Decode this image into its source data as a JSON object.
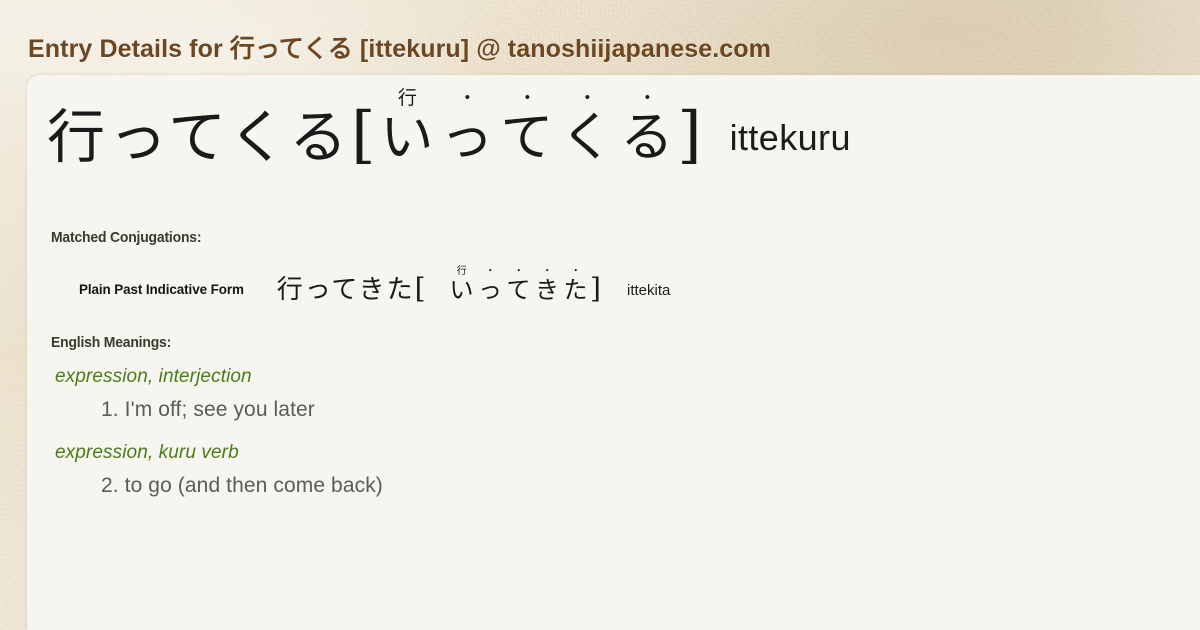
{
  "header": {
    "title": "Entry Details for 行ってくる [ittekuru] @ tanoshiijapanese.com",
    "title_color": "#6d4722"
  },
  "entry": {
    "headword": "行ってくる",
    "bracket_open": "[",
    "bracket_close": "]",
    "romaji": "ittekuru",
    "reading_units": [
      {
        "ruby": "行",
        "base": "い"
      },
      {
        "ruby": "・",
        "base": "っ"
      },
      {
        "ruby": "・",
        "base": "て"
      },
      {
        "ruby": "・",
        "base": "く"
      },
      {
        "ruby": "・",
        "base": "る"
      }
    ]
  },
  "conjugations": {
    "label": "Matched Conjugations:",
    "items": [
      {
        "name": "Plain Past Indicative Form",
        "kanji": "行ってきた",
        "bracket_open": "[",
        "bracket_close": "]",
        "romaji": "ittekita",
        "reading_units": [
          {
            "ruby": "行",
            "base": "い"
          },
          {
            "ruby": "・",
            "base": "っ"
          },
          {
            "ruby": "・",
            "base": "て"
          },
          {
            "ruby": "・",
            "base": "き"
          },
          {
            "ruby": "・",
            "base": "た"
          }
        ]
      }
    ]
  },
  "meanings": {
    "label": "English Meanings:",
    "pos_color": "#4a7d19",
    "groups": [
      {
        "pos": "expression, interjection",
        "sense": "1. I'm off; see you later"
      },
      {
        "pos": "expression, kuru verb",
        "sense": "2. to go (and then come back)"
      }
    ]
  }
}
